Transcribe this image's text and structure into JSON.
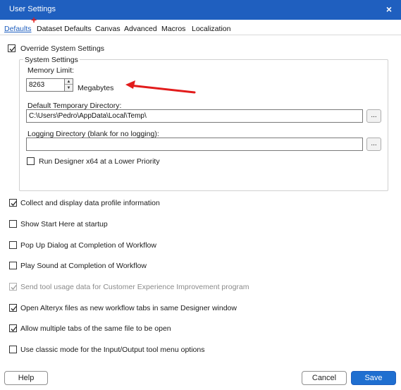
{
  "window": {
    "title": "User Settings",
    "close_glyph": "×"
  },
  "tabs": [
    "Defaults",
    "Dataset Defaults",
    "Canvas",
    "Advanced",
    "Macros",
    "Localization"
  ],
  "annotation": {
    "plus_glyph": "+",
    "color": "#e21c1c"
  },
  "override": {
    "label": "Override System Settings",
    "checked": true
  },
  "system_settings": {
    "title": "System Settings",
    "memory_label": "Memory Limit:",
    "memory_value": "8263",
    "memory_unit": "Megabytes",
    "temp_dir_label": "Default Temporary Directory:",
    "temp_dir_value": "C:\\Users\\Pedro\\AppData\\Local\\Temp\\",
    "logging_label": "Logging Directory (blank for no logging):",
    "logging_value": "",
    "browse_label": "...",
    "low_priority_label": "Run Designer x64 at a Lower Priority",
    "low_priority_checked": false
  },
  "options": [
    {
      "label": "Collect and display data profile information",
      "checked": true,
      "disabled": false
    },
    {
      "label": "Show Start Here at startup",
      "checked": false,
      "disabled": false
    },
    {
      "label": "Pop Up Dialog at Completion of Workflow",
      "checked": false,
      "disabled": false
    },
    {
      "label": "Play Sound at Completion of Workflow",
      "checked": false,
      "disabled": false
    },
    {
      "label": "Send tool usage data for Customer Experience Improvement program",
      "checked": true,
      "disabled": true
    },
    {
      "label": "Open Alteryx files as new workflow tabs in same Designer window",
      "checked": true,
      "disabled": false
    },
    {
      "label": "Allow multiple tabs of the same file to be open",
      "checked": true,
      "disabled": false
    },
    {
      "label": "Use classic mode for the Input/Output tool menu options",
      "checked": false,
      "disabled": false
    }
  ],
  "buttons": {
    "help": "Help",
    "cancel": "Cancel",
    "save": "Save"
  },
  "colors": {
    "titlebar": "#1f5fbf",
    "accent": "#1f6fd0",
    "arrow": "#e21c1c"
  }
}
